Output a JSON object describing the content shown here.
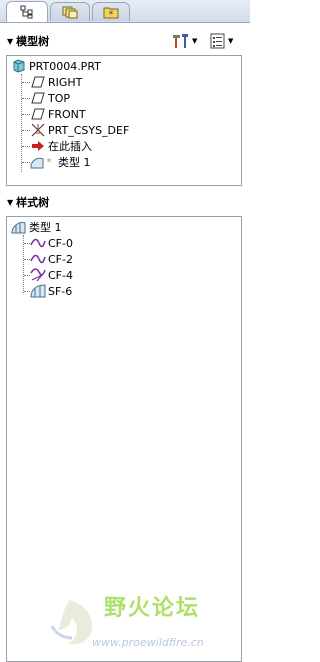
{
  "tabs": [
    {
      "icon": "model-tree-tab-icon",
      "active": true
    },
    {
      "icon": "folder-browser-tab-icon",
      "active": false
    },
    {
      "icon": "favorites-tab-icon",
      "active": false
    }
  ],
  "model_tree": {
    "title": "模型树",
    "root": "PRT0004.PRT",
    "items": [
      {
        "label": "RIGHT",
        "icon": "datum-plane-icon"
      },
      {
        "label": "TOP",
        "icon": "datum-plane-icon"
      },
      {
        "label": "FRONT",
        "icon": "datum-plane-icon"
      },
      {
        "label": "PRT_CSYS_DEF",
        "icon": "coordinate-system-icon"
      },
      {
        "label": "在此插入",
        "icon": "insert-here-arrow-icon"
      },
      {
        "label": "类型 1",
        "icon": "style-feature-icon"
      }
    ]
  },
  "style_tree": {
    "title": "样式树",
    "root": "类型 1",
    "items": [
      {
        "label": "CF-0",
        "icon": "curve-icon"
      },
      {
        "label": "CF-2",
        "icon": "curve-icon"
      },
      {
        "label": "CF-4",
        "icon": "curve-icon"
      },
      {
        "label": "SF-6",
        "icon": "surface-icon"
      }
    ]
  },
  "watermark": {
    "text": "野火论坛",
    "url": "www.proewildfire.cn"
  }
}
